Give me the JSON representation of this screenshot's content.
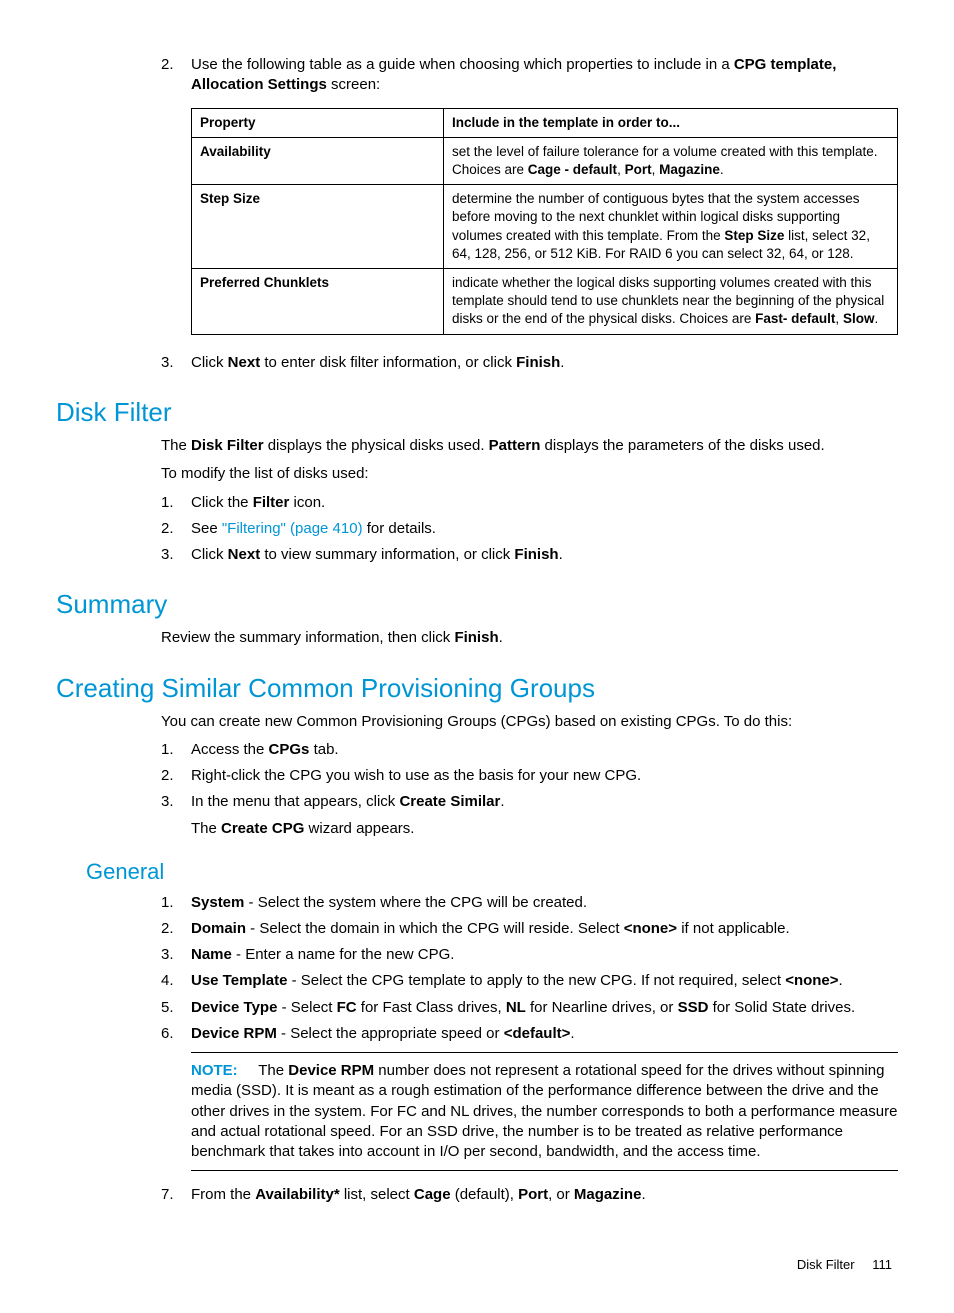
{
  "step2": {
    "num": "2.",
    "text_pre": "Use the following table as a guide when choosing which properties to include in a ",
    "bold1": "CPG template, Allocation Settings",
    "text_post": " screen:"
  },
  "table": {
    "h1": "Property",
    "h2": "Include in the template in order to...",
    "rows": [
      {
        "p": "Availability",
        "d_pre": "set the level of failure tolerance for a volume created with this template. Choices are ",
        "b1": "Cage - default",
        "sep1": ", ",
        "b2": "Port",
        "sep2": ", ",
        "b3": "Magazine",
        "post": "."
      },
      {
        "p": "Step Size",
        "d_pre": "determine the number of contiguous bytes that the system accesses before moving to the next chunklet within logical disks supporting volumes created with this template. From the ",
        "b1": "Step Size",
        "d_post": " list, select 32, 64, 128, 256, or 512 KiB. For RAID 6 you can select 32, 64, or 128."
      },
      {
        "p": "Preferred Chunklets",
        "d_pre": "indicate whether the logical disks supporting volumes created with this template should tend to use chunklets near the beginning of the physical disks or the end of the physical disks. Choices are ",
        "b1": "Fast- default",
        "sep1": ", ",
        "b2": "Slow",
        "post": "."
      }
    ]
  },
  "step3": {
    "num": "3.",
    "pre": "Click ",
    "b1": "Next",
    "mid": " to enter disk filter information, or click ",
    "b2": "Finish",
    "post": "."
  },
  "diskfilter": {
    "h": "Disk Filter",
    "p1_pre": "The ",
    "p1_b1": "Disk Filter",
    "p1_mid": " displays the physical disks used. ",
    "p1_b2": "Pattern",
    "p1_post": " displays the parameters of the disks used.",
    "p2": "To modify the list of disks used:",
    "s1": {
      "num": "1.",
      "pre": "Click the ",
      "b": "Filter",
      "post": " icon."
    },
    "s2": {
      "num": "2.",
      "pre": "See ",
      "link": "\"Filtering\" (page 410)",
      "post": " for details."
    },
    "s3": {
      "num": "3.",
      "pre": "Click ",
      "b1": "Next",
      "mid": " to view summary information, or click ",
      "b2": "Finish",
      "post": "."
    }
  },
  "summary": {
    "h": "Summary",
    "p_pre": "Review the summary information, then click ",
    "p_b": "Finish",
    "p_post": "."
  },
  "creating": {
    "h": "Creating Similar Common Provisioning Groups",
    "p": "You can create new Common Provisioning Groups (CPGs) based on existing CPGs. To do this:",
    "s1": {
      "num": "1.",
      "pre": "Access the ",
      "b": "CPGs",
      "post": " tab."
    },
    "s2": {
      "num": "2.",
      "text": "Right-click the CPG you wish to use as the basis for your new CPG."
    },
    "s3": {
      "num": "3.",
      "pre": "In the menu that appears, click ",
      "b": "Create Similar",
      "post": ".",
      "line2_pre": "The ",
      "line2_b": "Create CPG",
      "line2_post": " wizard appears."
    }
  },
  "general": {
    "h": "General",
    "s1": {
      "num": "1.",
      "b": "System",
      "post": " - Select the system where the CPG will be created."
    },
    "s2": {
      "num": "2.",
      "b": "Domain",
      "mid": " - Select the domain in which the CPG will reside. Select ",
      "b2": "<none>",
      "post": " if not applicable."
    },
    "s3": {
      "num": "3.",
      "b": "Name",
      "post": " - Enter a name for the new CPG."
    },
    "s4": {
      "num": "4.",
      "b": "Use Template",
      "mid": " - Select the CPG template to apply to the new CPG. If not required, select ",
      "b2": "<none>",
      "post": "."
    },
    "s5": {
      "num": "5.",
      "b": "Device Type",
      "t1": " - Select ",
      "b1": "FC",
      "t2": " for Fast Class drives, ",
      "b2": "NL",
      "t3": " for Nearline drives, or ",
      "b3": "SSD",
      "t4": " for Solid State drives."
    },
    "s6": {
      "num": "6.",
      "b": "Device RPM",
      "mid": " - Select the appropriate speed or ",
      "b2": "<default>",
      "post": "."
    },
    "note": {
      "label": "NOTE:",
      "pre": "The ",
      "b": "Device RPM",
      "post": " number does not represent a rotational speed for the drives without spinning media (SSD). It is meant as a rough estimation of the performance difference between the drive and the other drives in the system. For FC and NL drives, the number corresponds to both a performance measure and actual rotational speed. For an SSD drive, the number is to be treated as relative performance benchmark that takes into account in I/O per second, bandwidth, and the access time."
    },
    "s7": {
      "num": "7.",
      "pre": "From the ",
      "b1": "Availability*",
      "mid1": " list, select ",
      "b2": "Cage",
      "mid2": " (default), ",
      "b3": "Port",
      "mid3": ", or ",
      "b4": "Magazine",
      "post": "."
    }
  },
  "footer": {
    "section": "Disk Filter",
    "page": "111"
  }
}
